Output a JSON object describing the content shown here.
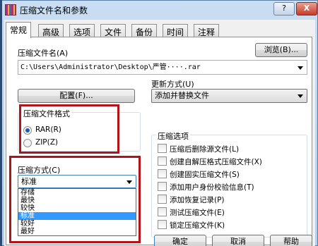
{
  "window": {
    "title": "压缩文件名和参数",
    "help_glyph": "?",
    "close_glyph": "X"
  },
  "tabs": [
    "常规",
    "高级",
    "选项",
    "文件",
    "备份",
    "时间",
    "注释"
  ],
  "general": {
    "archive_name_label": "压缩文件名(A)",
    "archive_name_value": "C:\\Users\\Administrator\\Desktop\\严管····.rar",
    "browse_button": "浏览(B)...",
    "profiles_button": "配置(F)...",
    "update_mode_label": "更新方式(U)",
    "update_mode_value": "添加并替换文件",
    "format_group": {
      "title": "压缩文件格式",
      "options": [
        "RAR(R)",
        "ZIP(Z)"
      ],
      "selected": "RAR(R)"
    },
    "method_label": "压缩方式(C)",
    "method_value": "标准",
    "method_options": [
      "存储",
      "最快",
      "较快",
      "标准",
      "较好",
      "最好"
    ],
    "method_selected": "标准",
    "options_group": {
      "title": "压缩选项",
      "items": [
        {
          "label": "压缩后删除源文件(L)",
          "checked": false
        },
        {
          "label": "创建自解压格式压缩文件(X)",
          "checked": false
        },
        {
          "label": "创建固实压缩文件(S)",
          "checked": false
        },
        {
          "label": "添加用户身份校验信息(T)",
          "checked": false
        },
        {
          "label": "添加恢复记录(P)",
          "checked": false
        },
        {
          "label": "测试压缩文件(E)",
          "checked": false
        },
        {
          "label": "锁定压缩文件(K)",
          "checked": false
        }
      ]
    }
  },
  "footer": {
    "ok_button": "确定",
    "cancel_button": "取消",
    "help_button": "帮助"
  },
  "colors": {
    "highlight": "#b0141a",
    "selection": "#3399ff"
  }
}
